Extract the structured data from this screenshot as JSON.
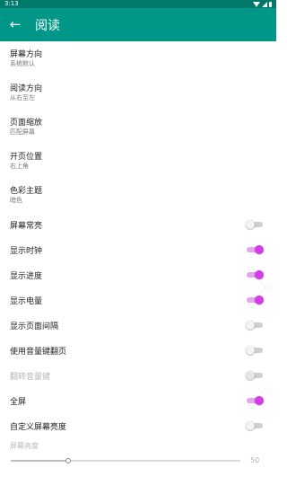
{
  "status_bar": {
    "time": "3:13",
    "icons": [
      "wifi-icon",
      "signal-icon",
      "battery-icon"
    ]
  },
  "app_bar": {
    "back_icon": "back-arrow-icon",
    "title": "阅读",
    "color": "#009688",
    "status_color": "#00796b"
  },
  "accent_color": "#d53be8",
  "options": [
    {
      "title": "屏幕方向",
      "subtitle": "系统默认"
    },
    {
      "title": "阅读方向",
      "subtitle": "从右至左"
    },
    {
      "title": "页面缩放",
      "subtitle": "匹配屏幕"
    },
    {
      "title": "开页位置",
      "subtitle": "右上角"
    },
    {
      "title": "色彩主题",
      "subtitle": "暗色"
    }
  ],
  "toggles": [
    {
      "label": "屏幕常亮",
      "on": false,
      "disabled": false
    },
    {
      "label": "显示时钟",
      "on": true,
      "disabled": false
    },
    {
      "label": "显示进度",
      "on": true,
      "disabled": false
    },
    {
      "label": "显示电量",
      "on": true,
      "disabled": false
    },
    {
      "label": "显示页面间隔",
      "on": false,
      "disabled": false
    },
    {
      "label": "使用音量键翻页",
      "on": false,
      "disabled": false
    },
    {
      "label": "翻转音量键",
      "on": false,
      "disabled": true
    },
    {
      "label": "全屏",
      "on": true,
      "disabled": false
    },
    {
      "label": "自定义屏幕亮度",
      "on": false,
      "disabled": false
    }
  ],
  "brightness": {
    "label": "屏幕亮度",
    "value": 50,
    "position": 0.25,
    "disabled": true
  }
}
